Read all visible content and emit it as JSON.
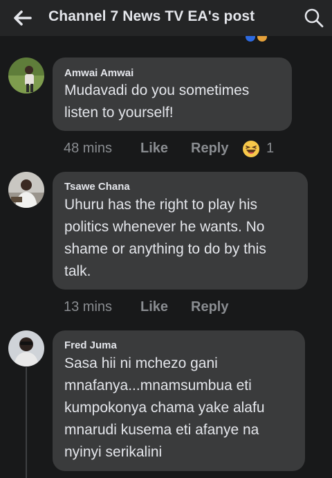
{
  "header": {
    "title": "Channel 7 News TV EA's post"
  },
  "icons": {
    "back": "arrow-left-icon",
    "search": "search-icon",
    "reaction": "laughing-emoji-icon"
  },
  "colors": {
    "background": "#18191a",
    "bubble": "#3a3b3c",
    "text": "#e4e6eb",
    "muted": "#8a8d91"
  },
  "comments": [
    {
      "author": "Amwai Amwai",
      "lines": [
        "Mudavadi do you sometimes",
        "listen to yourself!"
      ],
      "time": "48 mins",
      "like": "Like",
      "reply": "Reply",
      "reaction_count": "1"
    },
    {
      "author": "Tsawe Chana",
      "lines": [
        "Uhuru has the right to play his",
        "politics whenever he wants. No",
        "shame or anything to do by this",
        "talk."
      ],
      "time": "13 mins",
      "like": "Like",
      "reply": "Reply"
    },
    {
      "author": "Fred Juma",
      "lines": [
        "Sasa hii ni mchezo gani",
        "mnafanya...mnamsumbua eti",
        "kumpokonya chama yake alafu",
        "mnarudi kusema eti afanye na",
        "nyinyi serikalini"
      ]
    }
  ]
}
